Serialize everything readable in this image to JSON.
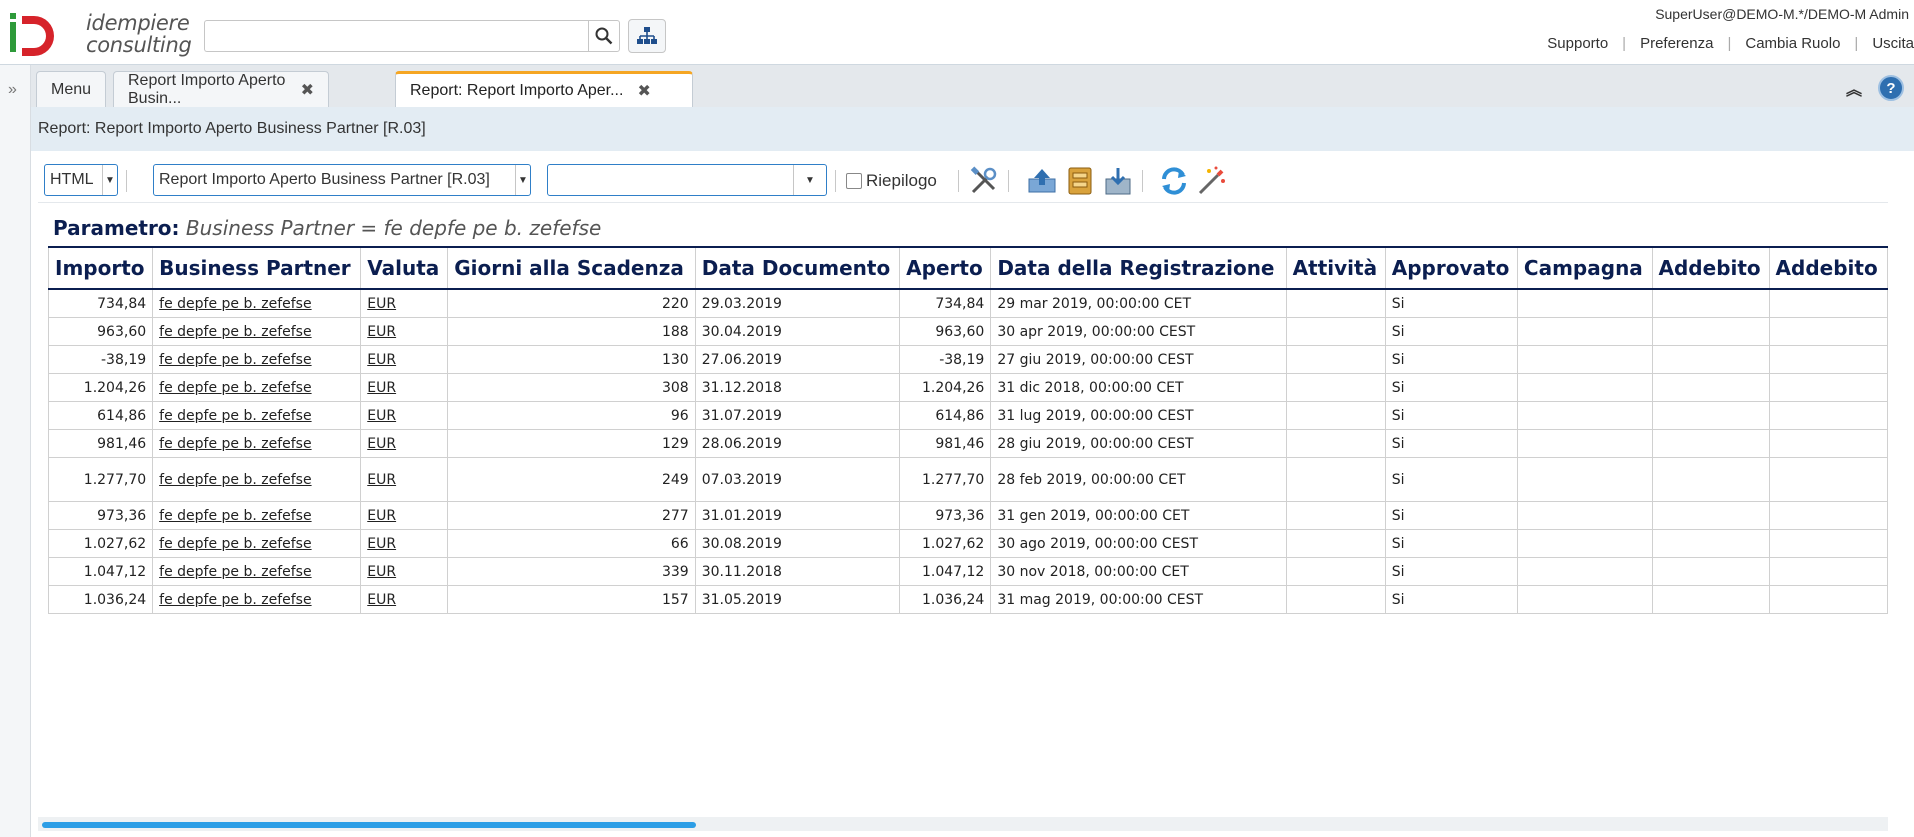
{
  "header": {
    "logo_line1": "idempiere",
    "logo_line2": "consulting",
    "search_placeholder": "",
    "user": "SuperUser@DEMO-M.*/DEMO-M Admin",
    "links": [
      "Supporto",
      "Preferenza",
      "Cambia Ruolo",
      "Uscita"
    ]
  },
  "tabs": [
    {
      "label": "Menu",
      "closable": false,
      "active": false
    },
    {
      "label": "Report Importo Aperto Busin...",
      "closable": true,
      "active": false
    },
    {
      "label": "Report: Report Importo Aper...",
      "closable": true,
      "active": true
    }
  ],
  "report_title": "Report: Report Importo Aperto Business Partner [R.03]",
  "toolbar": {
    "format_value": "HTML",
    "print_format_value": "Report Importo Aperto Business Partner [R.03]",
    "view_value": "",
    "summary_label": "Riepilogo",
    "summary_checked": false
  },
  "parameter": {
    "label": "Parametro:",
    "value": "Business Partner = fe depfe pe b. zefefse"
  },
  "report": {
    "columns": [
      "Importo",
      "Business Partner",
      "Valuta",
      "Giorni alla Scadenza",
      "Data Documento",
      "Aperto",
      "Data della Registrazione",
      "Attività",
      "Approvato",
      "Campagna",
      "Addebito",
      "Addebito"
    ],
    "rows": [
      [
        "734,84",
        "fe depfe pe b. zefefse",
        "EUR",
        "220",
        "29.03.2019",
        "734,84",
        "29 mar 2019, 00:00:00 CET",
        "",
        "Si",
        "",
        "",
        ""
      ],
      [
        "963,60",
        "fe depfe pe b. zefefse",
        "EUR",
        "188",
        "30.04.2019",
        "963,60",
        "30 apr 2019, 00:00:00 CEST",
        "",
        "Si",
        "",
        "",
        ""
      ],
      [
        "-38,19",
        "fe depfe pe b. zefefse",
        "EUR",
        "130",
        "27.06.2019",
        "-38,19",
        "27 giu 2019, 00:00:00 CEST",
        "",
        "Si",
        "",
        "",
        ""
      ],
      [
        "1.204,26",
        "fe depfe pe b. zefefse",
        "EUR",
        "308",
        "31.12.2018",
        "1.204,26",
        "31 dic 2018, 00:00:00 CET",
        "",
        "Si",
        "",
        "",
        ""
      ],
      [
        "614,86",
        "fe depfe pe b. zefefse",
        "EUR",
        "96",
        "31.07.2019",
        "614,86",
        "31 lug 2019, 00:00:00 CEST",
        "",
        "Si",
        "",
        "",
        ""
      ],
      [
        "981,46",
        "fe depfe pe b. zefefse",
        "EUR",
        "129",
        "28.06.2019",
        "981,46",
        "28 giu 2019, 00:00:00 CEST",
        "",
        "Si",
        "",
        "",
        ""
      ],
      [
        "1.277,70",
        "fe depfe pe b. zefefse",
        "EUR",
        "249",
        "07.03.2019",
        "1.277,70",
        "28 feb 2019, 00:00:00 CET",
        "",
        "Si",
        "",
        "",
        ""
      ],
      [
        "973,36",
        "fe depfe pe b. zefefse",
        "EUR",
        "277",
        "31.01.2019",
        "973,36",
        "31 gen 2019, 00:00:00 CET",
        "",
        "Si",
        "",
        "",
        ""
      ],
      [
        "1.027,62",
        "fe depfe pe b. zefefse",
        "EUR",
        "66",
        "30.08.2019",
        "1.027,62",
        "30 ago 2019, 00:00:00 CEST",
        "",
        "Si",
        "",
        "",
        ""
      ],
      [
        "1.047,12",
        "fe depfe pe b. zefefse",
        "EUR",
        "339",
        "30.11.2018",
        "1.047,12",
        "30 nov 2018, 00:00:00 CET",
        "",
        "Si",
        "",
        "",
        ""
      ],
      [
        "1.036,24",
        "fe depfe pe b. zefefse",
        "EUR",
        "157",
        "31.05.2019",
        "1.036,24",
        "31 mag 2019, 00:00:00 CEST",
        "",
        "Si",
        "",
        "",
        ""
      ]
    ]
  }
}
